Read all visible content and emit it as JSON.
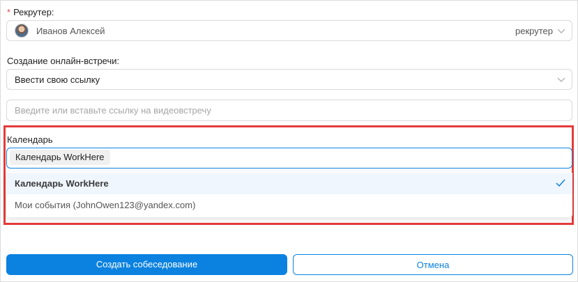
{
  "recruiter": {
    "required_mark": "*",
    "label": "Рекрутер:",
    "name": "Иванов Алексей",
    "role": "рекрутер"
  },
  "meeting": {
    "label": "Создание онлайн-встречи:",
    "selected": "Ввести свою ссылку"
  },
  "link_input": {
    "placeholder": "Введите или вставьте ссылку на видеовстречу"
  },
  "calendar": {
    "label": "Календарь",
    "selected_tag": "Календарь WorkHere",
    "options": [
      {
        "label": "Календарь WorkHere",
        "selected": true
      },
      {
        "label": "Мои события (JohnOwen123@yandex.com)",
        "selected": false
      }
    ]
  },
  "actions": {
    "submit_label": "Создать собеседование",
    "cancel_label": "Отмена"
  },
  "colors": {
    "accent": "#0b82e0",
    "highlight": "#e53b3b",
    "required": "#e5484d"
  }
}
